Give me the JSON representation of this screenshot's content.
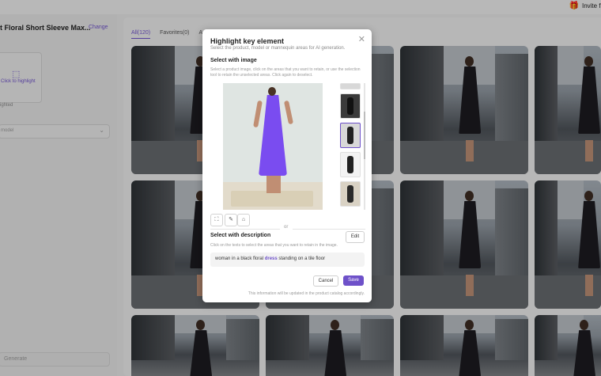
{
  "topbar": {
    "invite_label": "Invite fri"
  },
  "left_panel": {
    "product_title": "t Floral Short Sleeve Max...",
    "change_label": "Change",
    "highlight_label": "Click to highlight",
    "highlight_sub": "ighted",
    "model_select_value": "model",
    "generate_label": "Generate"
  },
  "tabs": [
    {
      "label": "All(120)",
      "active": true
    },
    {
      "label": "Favorites(0)",
      "active": false
    },
    {
      "label": "Arc",
      "active": false
    }
  ],
  "modal": {
    "title": "Highlight key element",
    "subtitle": "Select the product, model or mannequin areas for AI generation.",
    "section_image": {
      "title": "Select with image",
      "description": "Select a product image, click on the areas that you want to retain, or use the selection tool to retain the unselected areas. Click again to deselect."
    },
    "or_label": "or",
    "section_description": {
      "title": "Select with description",
      "description": "Click on the texts to select the areas that you want to retain in the image.",
      "edit_label": "Edit",
      "text_before": "woman in a black floral",
      "keyword": "dress",
      "text_after": "standing on a tile floor"
    },
    "cancel_label": "Cancel",
    "save_label": "Save",
    "footer_note": "This information will be updated in the product catalog accordingly."
  },
  "colors": {
    "accent": "#6e51c9",
    "dress_highlight": "#7a4cf0"
  }
}
